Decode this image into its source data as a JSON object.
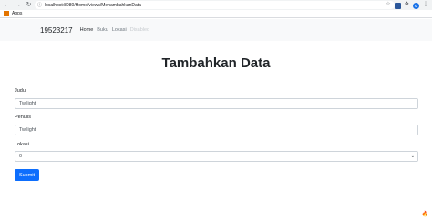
{
  "browser": {
    "url": "localhost:8080/Home/views/MenambahkanData",
    "bookmarks_label": "Apps",
    "profile_initial": "M"
  },
  "navbar": {
    "brand": "19523217",
    "links": [
      {
        "label": "Home"
      },
      {
        "label": "Buku"
      },
      {
        "label": "Lokasi"
      },
      {
        "label": "Disabled"
      }
    ]
  },
  "form": {
    "title": "Tambahkan Data",
    "fields": {
      "judul": {
        "label": "Judul",
        "value": "Twilight"
      },
      "penulis": {
        "label": "Penulis",
        "value": "Twilight"
      },
      "lokasi": {
        "label": "Lokasi",
        "value": "0"
      }
    },
    "submit_label": "Submit"
  },
  "icons": {
    "back": "arrow-left-icon",
    "forward": "arrow-right-icon",
    "reload": "reload-icon",
    "info": "info-icon",
    "star": "star-icon",
    "extension": "extension-icon",
    "puzzle": "puzzle-icon",
    "menu": "kebab-menu-icon",
    "select_arrow": "chevron-down-icon",
    "corner": "flame-icon"
  }
}
